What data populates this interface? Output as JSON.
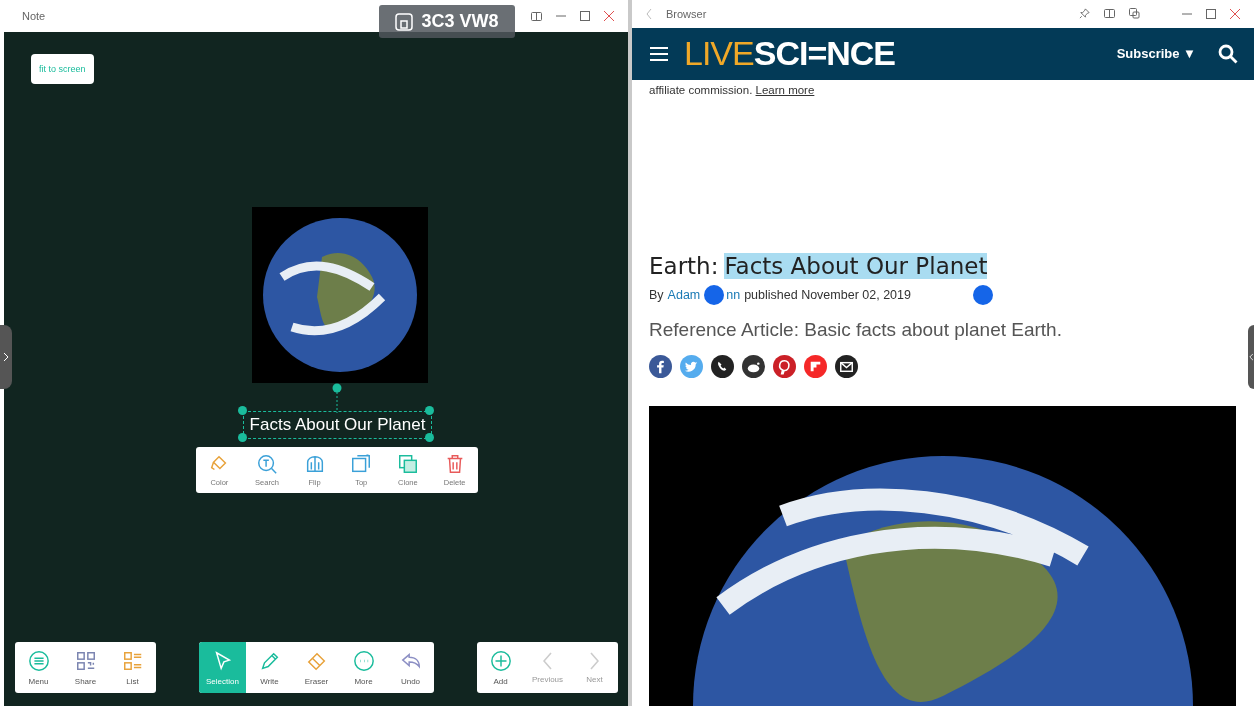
{
  "note_window": {
    "title": "Note",
    "fit_button": "fit to screen",
    "text_box": "Facts About Our Planet",
    "context_menu": [
      {
        "label": "Color"
      },
      {
        "label": "Search"
      },
      {
        "label": "Flip"
      },
      {
        "label": "Top"
      },
      {
        "label": "Clone"
      },
      {
        "label": "Delete"
      }
    ],
    "toolbars": [
      [
        {
          "label": "Menu",
          "selected": false,
          "disabled": false
        },
        {
          "label": "Share",
          "selected": false,
          "disabled": false
        },
        {
          "label": "List",
          "selected": false,
          "disabled": false
        }
      ],
      [
        {
          "label": "Selection",
          "selected": true,
          "disabled": false
        },
        {
          "label": "Write",
          "selected": false,
          "disabled": false
        },
        {
          "label": "Eraser",
          "selected": false,
          "disabled": false
        },
        {
          "label": "More",
          "selected": false,
          "disabled": false
        },
        {
          "label": "Undo",
          "selected": false,
          "disabled": false
        }
      ],
      [
        {
          "label": "Add",
          "selected": false,
          "disabled": false
        },
        {
          "label": "Previous",
          "selected": false,
          "disabled": true
        },
        {
          "label": "Next",
          "selected": false,
          "disabled": true
        }
      ]
    ]
  },
  "cast_badge": {
    "code": "3C3 VW8"
  },
  "browser_window": {
    "title": "Browser",
    "site": {
      "logo_left": "LIVE",
      "logo_right": "SCI=NCE",
      "subscribe": "Subscribe ▼"
    },
    "disclaimer": {
      "text": "affiliate commission.",
      "link": "Learn more"
    },
    "headline": [
      {
        "text": "Earth:",
        "selected": false
      },
      {
        "text": "Facts About Our Planet",
        "selected": true
      }
    ],
    "byline": {
      "prefix": "By",
      "author_parts": [
        "Adam",
        "nn"
      ],
      "published": "published November 02, 2019"
    },
    "summary": "Reference Article: Basic facts about planet Earth.",
    "share_buttons": [
      {
        "color": "#3b5998"
      },
      {
        "color": "#55acee"
      },
      {
        "color": "#222222"
      },
      {
        "color": "#333333"
      },
      {
        "color": "#cb2027"
      },
      {
        "color": "#f52828"
      },
      {
        "color": "#222222"
      }
    ]
  }
}
